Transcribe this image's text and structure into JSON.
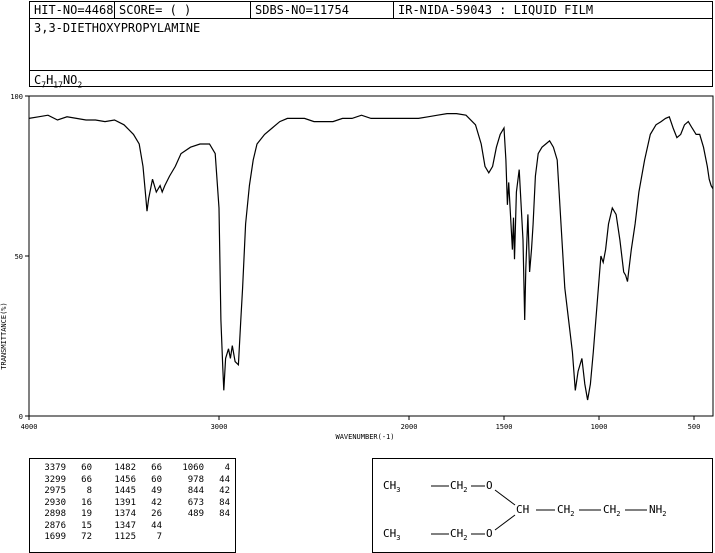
{
  "header": {
    "hit_no": "HIT-NO=4468",
    "score": "SCORE=  (   )",
    "sdbs_no": "SDBS-NO=11754",
    "method": "IR-NIDA-59043 : LIQUID FILM",
    "compound_name": "3,3-DIETHOXYPROPYLAMINE",
    "formula": {
      "c": "C",
      "c_n": "7",
      "h": "H",
      "h_n": "17",
      "n": "N",
      "o": "O",
      "o_n": "2"
    }
  },
  "chart_data": {
    "type": "line",
    "xlabel": "WAVENUMBER(-1)",
    "ylabel": "TRANSMITTANCE(%)",
    "xlim": [
      4000,
      400
    ],
    "ylim": [
      0,
      100
    ],
    "x_ticks": [
      4000,
      3000,
      2000,
      1500,
      1000,
      500
    ],
    "y_ticks": [
      0,
      50,
      100
    ],
    "grid": false,
    "series": [
      {
        "x": [
          4000,
          3950,
          3900,
          3850,
          3800,
          3750,
          3700,
          3650,
          3600,
          3550,
          3500,
          3450,
          3420,
          3400,
          3385,
          3379,
          3370,
          3350,
          3330,
          3310,
          3299,
          3285,
          3260,
          3230,
          3200,
          3150,
          3100,
          3050,
          3020,
          3000,
          2990,
          2980,
          2975,
          2965,
          2950,
          2940,
          2930,
          2915,
          2898,
          2885,
          2876,
          2860,
          2840,
          2820,
          2800,
          2760,
          2720,
          2680,
          2640,
          2600,
          2550,
          2500,
          2450,
          2400,
          2350,
          2300,
          2250,
          2200,
          2150,
          2100,
          2050,
          2000,
          1950,
          1900,
          1850,
          1800,
          1750,
          1700,
          1650,
          1620,
          1600,
          1580,
          1560,
          1540,
          1520,
          1500,
          1490,
          1482,
          1475,
          1468,
          1456,
          1450,
          1445,
          1435,
          1420,
          1410,
          1400,
          1391,
          1385,
          1374,
          1365,
          1355,
          1347,
          1335,
          1320,
          1300,
          1280,
          1260,
          1240,
          1220,
          1200,
          1180,
          1160,
          1140,
          1125,
          1110,
          1090,
          1075,
          1060,
          1045,
          1030,
          1010,
          990,
          978,
          965,
          950,
          930,
          910,
          890,
          870,
          860,
          850,
          844,
          830,
          810,
          790,
          760,
          730,
          700,
          673,
          650,
          630,
          610,
          590,
          570,
          550,
          530,
          510,
          489,
          470,
          450,
          430,
          420,
          410,
          400
        ],
        "y": [
          93,
          93.5,
          94,
          92.5,
          93.5,
          93,
          92.5,
          92.5,
          92,
          92.5,
          91,
          88,
          85,
          78,
          68,
          64,
          68,
          74,
          70,
          72,
          70,
          72,
          75,
          78,
          82,
          84,
          85,
          85,
          82,
          65,
          30,
          15,
          8,
          18,
          21,
          18,
          22,
          17,
          16,
          30,
          40,
          60,
          72,
          80,
          85,
          88,
          90,
          92,
          93,
          93,
          93,
          92,
          92,
          92,
          93,
          93,
          94,
          93,
          93,
          93,
          93,
          93,
          93,
          93.5,
          94,
          94.5,
          94.5,
          94,
          91,
          85,
          78,
          76,
          78,
          84,
          88,
          90,
          80,
          66,
          73,
          65,
          52,
          62,
          49,
          70,
          77,
          66,
          55,
          30,
          46,
          63,
          45,
          52,
          60,
          75,
          82,
          84,
          85,
          86,
          84,
          80,
          60,
          40,
          30,
          20,
          8,
          14,
          18,
          10,
          5,
          10,
          20,
          35,
          50,
          48,
          52,
          60,
          65,
          63,
          55,
          45,
          44,
          42,
          45,
          52,
          60,
          70,
          80,
          88,
          91,
          92,
          93,
          93.5,
          90,
          87,
          88,
          91,
          92,
          90,
          88,
          88,
          84,
          78,
          74,
          72,
          71
        ]
      }
    ]
  },
  "peak_table": {
    "columns": [
      [
        [
          "3379",
          "60"
        ],
        [
          "3299",
          "66"
        ],
        [
          "2975",
          "8"
        ],
        [
          "2930",
          "16"
        ],
        [
          "2898",
          "19"
        ],
        [
          "2876",
          "15"
        ],
        [
          "1699",
          "72"
        ]
      ],
      [
        [
          "1482",
          "66"
        ],
        [
          "1456",
          "60"
        ],
        [
          "1445",
          "49"
        ],
        [
          "1391",
          "42"
        ],
        [
          "1374",
          "26"
        ],
        [
          "1347",
          "44"
        ],
        [
          "1125",
          "7"
        ]
      ],
      [
        [
          "1060",
          "4"
        ],
        [
          "978",
          "44"
        ],
        [
          "844",
          "42"
        ],
        [
          "673",
          "84"
        ],
        [
          "489",
          "84"
        ]
      ]
    ]
  },
  "structure": {
    "ch3": "CH",
    "three": "3",
    "ch2": "CH",
    "two": "2",
    "ch": "CH",
    "o": "O",
    "nh2": "NH",
    "dash": "—"
  }
}
